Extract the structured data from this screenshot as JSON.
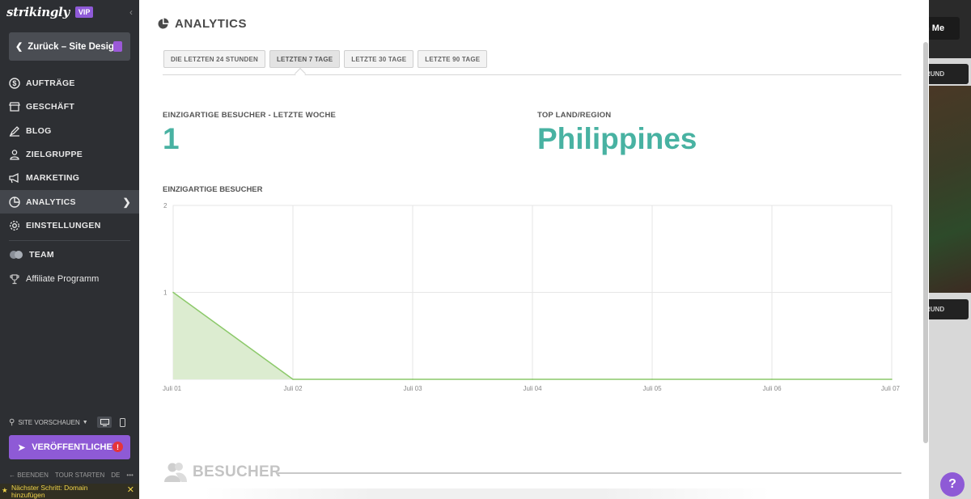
{
  "sidebar": {
    "logo": "strikingly",
    "vip_badge": "VIP",
    "back_button": "Zurück – Site Design",
    "nav": [
      {
        "label": "AUFTRÄGE",
        "icon": "dollar-circle-icon"
      },
      {
        "label": "GESCHÄFT",
        "icon": "store-icon"
      },
      {
        "label": "BLOG",
        "icon": "pen-icon"
      },
      {
        "label": "ZIELGRUPPE",
        "icon": "people-icon"
      },
      {
        "label": "MARKETING",
        "icon": "megaphone-icon"
      },
      {
        "label": "ANALYTICS",
        "icon": "pie-chart-icon",
        "active": true
      },
      {
        "label": "EINSTELLUNGEN",
        "icon": "gear-icon"
      },
      {
        "label": "TEAM",
        "icon": "team-avatars-icon"
      },
      {
        "label": "Affiliate Programm",
        "icon": "trophy-icon"
      }
    ],
    "preview_label": "SITE VORSCHAUEN",
    "publish_button": "VERÖFFENTLICHEN",
    "bottom_links": [
      "BEENDEN",
      "TOUR STARTEN",
      "DE",
      "•••"
    ],
    "next_step_line1": "Nächster Schritt: Domain",
    "next_step_line2": "hinzufügen"
  },
  "background": {
    "button_text": "h Me",
    "pill_text": "RUND"
  },
  "panel": {
    "title": "ANALYTICS",
    "tabs": [
      "DIE LETZTEN 24 STUNDEN",
      "LETZTEN 7 TAGE",
      "LETZTE 30 TAGE",
      "LETZTE 90 TAGE"
    ],
    "active_tab": "LETZTEN 7 TAGE",
    "unique_label": "EINZIGARTIGE BESUCHER - LETZTE WOCHE",
    "unique_value": "1",
    "top_country_label": "TOP LAND/REGION",
    "top_country": "Philippines",
    "chart_label": "EINZIGARTIGE BESUCHER",
    "besucher_heading": "BESUCHER"
  },
  "help_button": "?",
  "colors": {
    "accent_teal": "#48b2a2",
    "publish_purple": "#8e5ad6",
    "chart_line": "#8cc96a",
    "chart_fill": "#dcecd0"
  },
  "chart_data": {
    "type": "area",
    "x": [
      "Juli 01",
      "Juli 02",
      "Juli 03",
      "Juli 04",
      "Juli 05",
      "Juli 06",
      "Juli 07"
    ],
    "series": [
      {
        "values": [
          1,
          0,
          0,
          0,
          0,
          0,
          0
        ]
      }
    ],
    "ylim": [
      0,
      2
    ],
    "yticks": [
      1,
      2
    ],
    "title": "EINZIGARTIGE BESUCHER",
    "grid": true
  }
}
